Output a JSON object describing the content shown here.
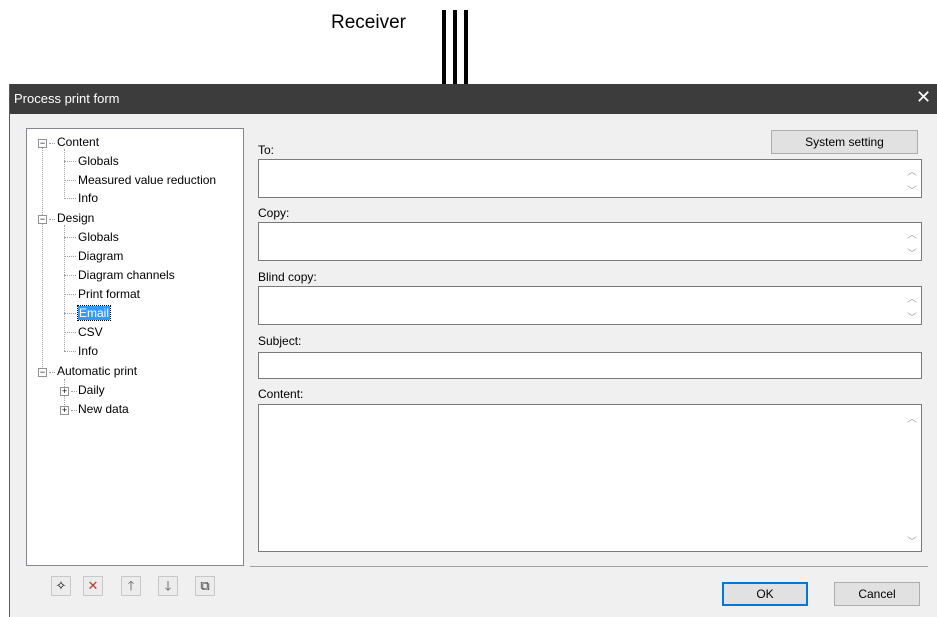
{
  "callout": {
    "label": "Receiver"
  },
  "window": {
    "title": "Process print form",
    "close_glyph": "✕"
  },
  "tree": {
    "content": {
      "label": "Content",
      "children": [
        "Globals",
        "Measured value reduction",
        "Info"
      ]
    },
    "design": {
      "label": "Design",
      "children": [
        "Globals",
        "Diagram",
        "Diagram channels",
        "Print format",
        "Email",
        "CSV",
        "Info"
      ]
    },
    "auto": {
      "label": "Automatic print",
      "children": [
        "Daily",
        "New data"
      ]
    },
    "selected": "Email"
  },
  "form": {
    "to_label": "To:",
    "copy_label": "Copy:",
    "blind_copy_label": "Blind copy:",
    "subject_label": "Subject:",
    "content_label": "Content:",
    "to_value": "",
    "copy_value": "",
    "blind_copy_value": "",
    "subject_value": "",
    "content_value": "",
    "system_setting_button": "System setting"
  },
  "toolbar": {
    "icons": [
      "new-icon",
      "delete-icon",
      "move-up-icon",
      "move-down-icon",
      "copy-icon"
    ]
  },
  "footer": {
    "ok_label": "OK",
    "cancel_label": "Cancel"
  },
  "colors": {
    "titlebar": "#3c3c3c",
    "selection": "#3399ff",
    "default_button_border": "#0078d7"
  }
}
